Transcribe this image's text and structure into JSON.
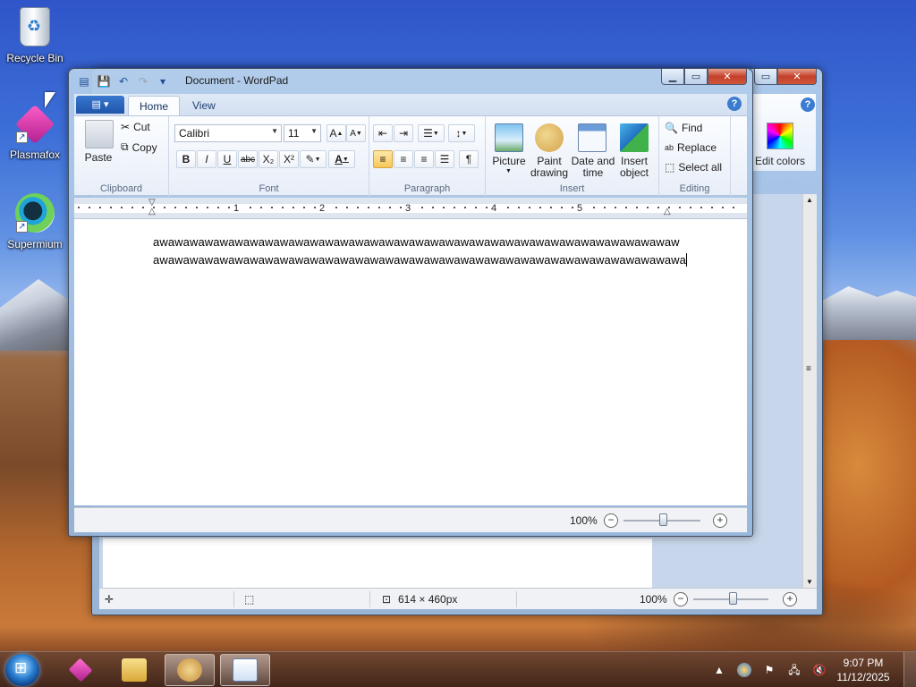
{
  "desktop": {
    "icons": [
      {
        "label": "Recycle Bin"
      },
      {
        "label": "Plasmafox"
      },
      {
        "label": "Supermium"
      }
    ]
  },
  "paint_window": {
    "edit_colors_label": "Edit colors",
    "status": {
      "selection_size": "614 × 460px",
      "zoom": "100%"
    }
  },
  "wordpad": {
    "title": "Document - WordPad",
    "tabs": [
      "Home",
      "View"
    ],
    "active_tab": "Home",
    "clipboard": {
      "paste": "Paste",
      "cut": "Cut",
      "copy": "Copy",
      "group": "Clipboard"
    },
    "font": {
      "family": "Calibri",
      "size": "11",
      "group": "Font",
      "bold": "B",
      "italic": "I",
      "underline": "U",
      "strike": "abc",
      "sub": "X₂",
      "sup": "X²",
      "color": "A"
    },
    "paragraph": {
      "group": "Paragraph"
    },
    "insert": {
      "picture": "Picture",
      "paint_drawing": "Paint\ndrawing",
      "date_time": "Date and\ntime",
      "insert_object": "Insert\nobject",
      "group": "Insert"
    },
    "editing": {
      "find": "Find",
      "replace": "Replace",
      "select_all": "Select all",
      "group": "Editing"
    },
    "ruler_numbers": [
      "1",
      "2",
      "3",
      "4",
      "5"
    ],
    "document_lines": [
      "awawawawawawawawawawawawawawawawawawawawawawawawawawawawawawawawawawaw",
      "awawawawawawawawawawawawawawawawawawawawawawawawawawawawawawawawawawawa"
    ],
    "zoom": "100%"
  },
  "taskbar": {
    "time": "9:07 PM",
    "date": "11/12/2025"
  }
}
